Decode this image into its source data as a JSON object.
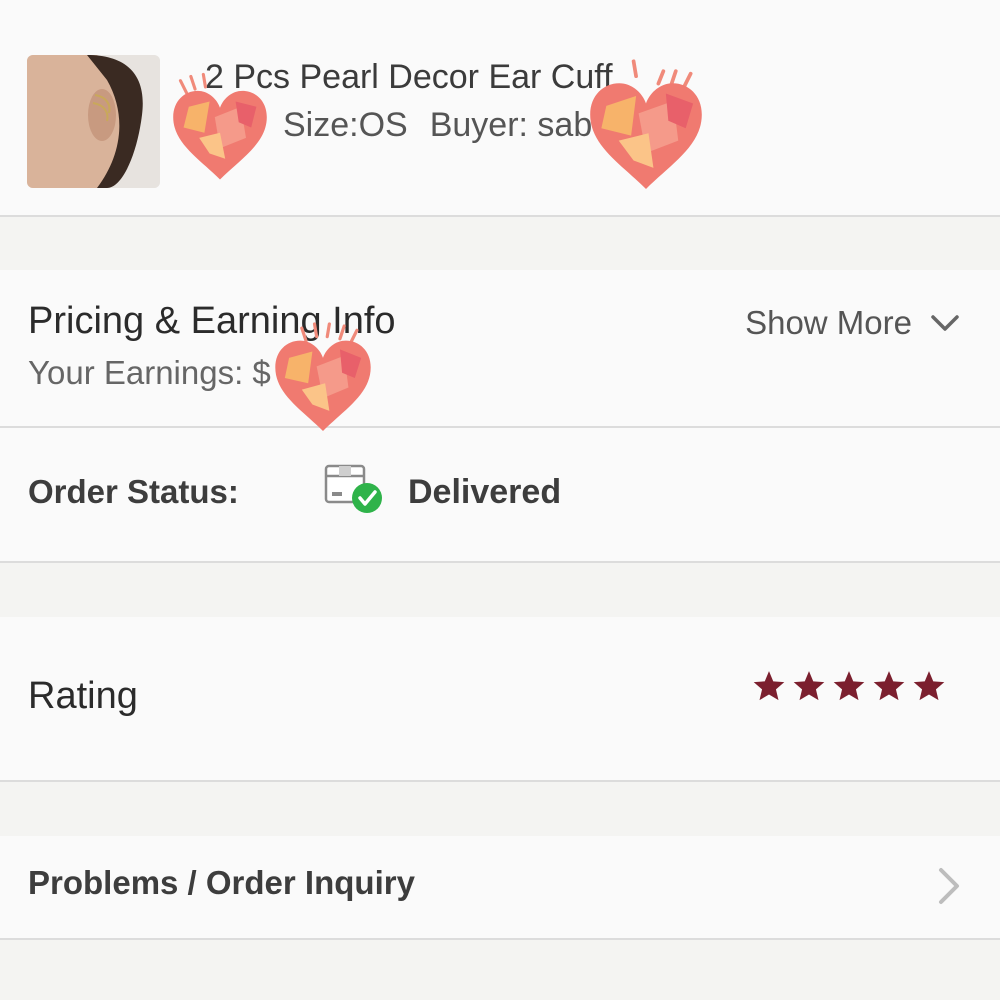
{
  "product": {
    "title": "2 Pcs Pearl Decor Ear Cuff",
    "size": "Size:OS",
    "buyer": "Buyer: sab"
  },
  "pricing": {
    "title": "Pricing & Earning Info",
    "earnings": "Your Earnings: $",
    "show_more": "Show More",
    "show_more_icon": "chevron-down-icon"
  },
  "status": {
    "label": "Order Status:",
    "value": "Delivered",
    "icon": "package-delivered-icon",
    "check_color": "#2fb34a"
  },
  "rating": {
    "label": "Rating",
    "stars": 5,
    "max_stars": 5,
    "star_color": "#7b1f2e"
  },
  "problems": {
    "label": "Problems / Order Inquiry",
    "icon": "chevron-right-icon"
  },
  "stickers": {
    "icon": "heart-sticker-icon"
  }
}
